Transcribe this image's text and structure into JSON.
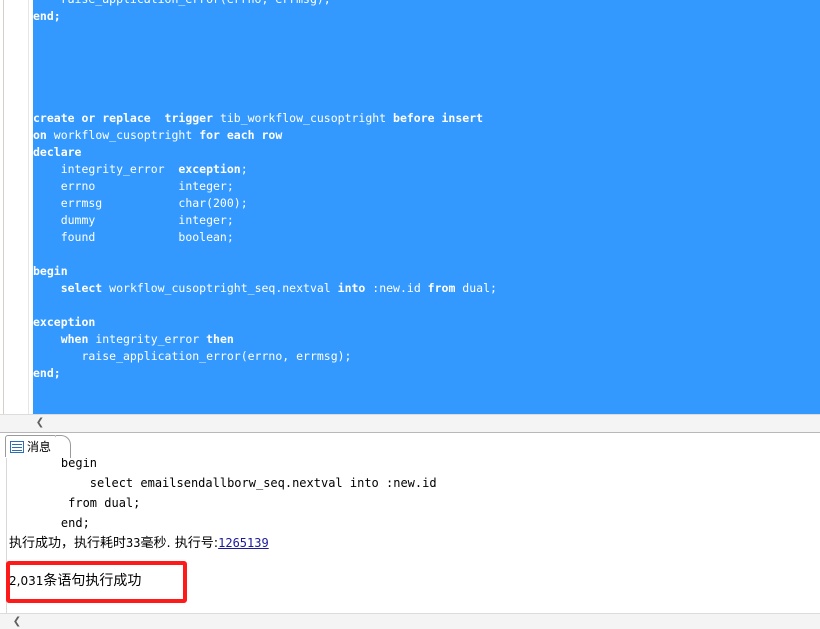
{
  "editor": {
    "code_lines": [
      {
        "segments": [
          {
            "t": "    raise_application_error(errno, errmsg);",
            "kw": false
          }
        ]
      },
      {
        "segments": [
          {
            "t": "end;",
            "kw": true
          }
        ]
      },
      {
        "segments": []
      },
      {
        "segments": []
      },
      {
        "segments": []
      },
      {
        "segments": []
      },
      {
        "segments": []
      },
      {
        "segments": [
          {
            "t": "create or replace  trigger",
            "kw": true
          },
          {
            "t": " tib_workflow_cusoptright ",
            "kw": false
          },
          {
            "t": "before insert",
            "kw": true
          }
        ]
      },
      {
        "segments": [
          {
            "t": "on",
            "kw": true
          },
          {
            "t": " workflow_cusoptright ",
            "kw": false
          },
          {
            "t": "for each row",
            "kw": true
          }
        ]
      },
      {
        "segments": [
          {
            "t": "declare",
            "kw": true
          }
        ]
      },
      {
        "segments": [
          {
            "t": "    integrity_error  ",
            "kw": false
          },
          {
            "t": "exception",
            "kw": true
          },
          {
            "t": ";",
            "kw": false
          }
        ]
      },
      {
        "segments": [
          {
            "t": "    errno            integer;",
            "kw": false
          }
        ]
      },
      {
        "segments": [
          {
            "t": "    errmsg           char(200);",
            "kw": false
          }
        ]
      },
      {
        "segments": [
          {
            "t": "    dummy            integer;",
            "kw": false
          }
        ]
      },
      {
        "segments": [
          {
            "t": "    found            boolean;",
            "kw": false
          }
        ]
      },
      {
        "segments": []
      },
      {
        "segments": [
          {
            "t": "begin",
            "kw": true
          }
        ]
      },
      {
        "segments": [
          {
            "t": "    select",
            "kw": true
          },
          {
            "t": " workflow_cusoptright_seq.nextval ",
            "kw": false
          },
          {
            "t": "into",
            "kw": true
          },
          {
            "t": " :new.id ",
            "kw": false
          },
          {
            "t": "from",
            "kw": true
          },
          {
            "t": " dual;",
            "kw": false
          }
        ]
      },
      {
        "segments": []
      },
      {
        "segments": [
          {
            "t": "exception",
            "kw": true
          }
        ]
      },
      {
        "segments": [
          {
            "t": "    when",
            "kw": true
          },
          {
            "t": " integrity_error ",
            "kw": false
          },
          {
            "t": "then",
            "kw": true
          }
        ]
      },
      {
        "segments": [
          {
            "t": "       raise_application_error(errno, errmsg);",
            "kw": false
          }
        ]
      },
      {
        "segments": [
          {
            "t": "end;",
            "kw": true
          }
        ]
      }
    ]
  },
  "tabs": [
    {
      "label": "消息",
      "icon": "message-icon",
      "active": true
    }
  ],
  "messages": {
    "lines": [
      "    begin",
      "        select emailsendallborw_seq.nextval into :new.id",
      "     from dual;",
      "    end;"
    ],
    "status_prefix": "执行成功，执行耗时",
    "status_ms": "33",
    "status_mid": "毫秒. 执行号:",
    "exec_number": "1265139",
    "result_count": "2,031",
    "result_suffix": "条语句执行成功"
  },
  "colors": {
    "selection": "#3399ff",
    "highlight_box": "#ff1a1a"
  }
}
